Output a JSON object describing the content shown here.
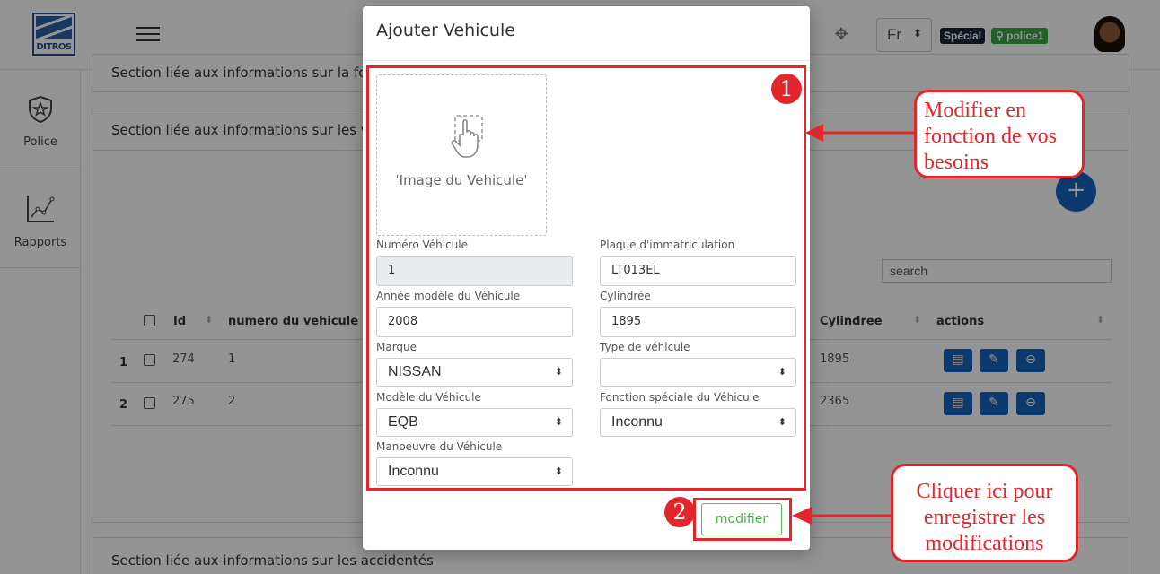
{
  "app": {
    "logo_text": "DITROS",
    "language": "Fr",
    "badge_special": "Spécial",
    "badge_user": "police1"
  },
  "sidebar": {
    "items": [
      {
        "label": "Police",
        "icon": "shield-star-icon"
      },
      {
        "label": "Rapports",
        "icon": "line-chart-icon"
      }
    ]
  },
  "background": {
    "section1_title": "Section liée aux informations sur la fo",
    "section2_title": "Section liée aux informations sur les ve",
    "section3_title": "Section liée aux informations sur les accidentés",
    "search_placeholder": "search",
    "table": {
      "headers": [
        "Id",
        "numero du vehicule",
        "Cylindree",
        "actions"
      ],
      "rows": [
        {
          "index": "1",
          "id": "274",
          "numero": "1",
          "cylindree": "1895"
        },
        {
          "index": "2",
          "id": "275",
          "numero": "2",
          "cylindree": "2365"
        }
      ]
    }
  },
  "modal": {
    "title": "Ajouter Vehicule",
    "image_placeholder": "'Image du Vehicule'",
    "fields": {
      "numero": {
        "label": "Numéro Véhicule",
        "value": "1"
      },
      "plaque": {
        "label": "Plaque d'immatriculation",
        "value": "LT013EL"
      },
      "annee": {
        "label": "Année modèle du Véhicule",
        "value": "2008"
      },
      "cylindree": {
        "label": "Cylindrée",
        "value": "1895"
      },
      "marque": {
        "label": "Marque",
        "value": "NISSAN"
      },
      "type": {
        "label": "Type de véhicule",
        "value": ""
      },
      "modele": {
        "label": "Modèle du Véhicule",
        "value": "EQB"
      },
      "fonction": {
        "label": "Fonction spéciale du Véhicule",
        "value": "Inconnu"
      },
      "manoeuvre": {
        "label": "Manoeuvre du Véhicule",
        "value": "Inconnu"
      }
    },
    "submit_label": "modifier"
  },
  "annotations": {
    "marker1": "1",
    "marker2": "2",
    "callout1": [
      "Modifier en",
      "fonction de vos",
      "besoins"
    ],
    "callout2": [
      "Cliquer ici pour",
      "enregistrer les",
      "modifications"
    ],
    "accent_color": "#e3262c"
  }
}
